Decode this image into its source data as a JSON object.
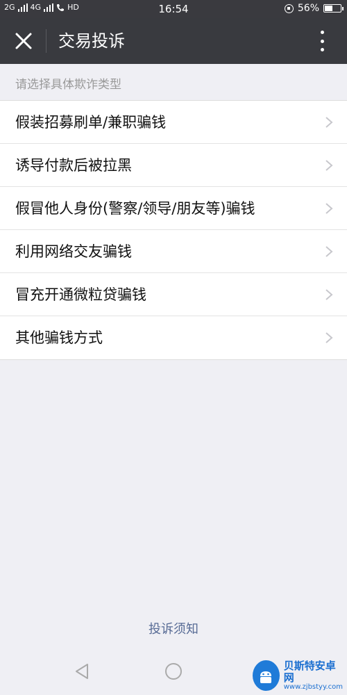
{
  "status_bar": {
    "signal_left": "2G",
    "signal_mid": "4G",
    "hd": "HD",
    "time": "16:54",
    "battery": "56%",
    "battery_level": 0.56
  },
  "nav": {
    "title": "交易投诉",
    "close_icon": "close-icon",
    "more_icon": "more-vertical-icon"
  },
  "section_hint": "请选择具体欺诈类型",
  "items": [
    {
      "label": "假装招募刷单/兼职骗钱"
    },
    {
      "label": "诱导付款后被拉黑"
    },
    {
      "label": "假冒他人身份(警察/领导/朋友等)骗钱"
    },
    {
      "label": "利用网络交友骗钱"
    },
    {
      "label": "冒充开通微粒贷骗钱"
    },
    {
      "label": "其他骗钱方式"
    }
  ],
  "footer_link": "投诉须知",
  "watermark": {
    "title": "贝斯特安卓网",
    "url": "www.zjbstyy.com"
  },
  "colors": {
    "nav_bg": "#393a3f",
    "page_bg": "#efeff4",
    "link": "#576b95"
  }
}
